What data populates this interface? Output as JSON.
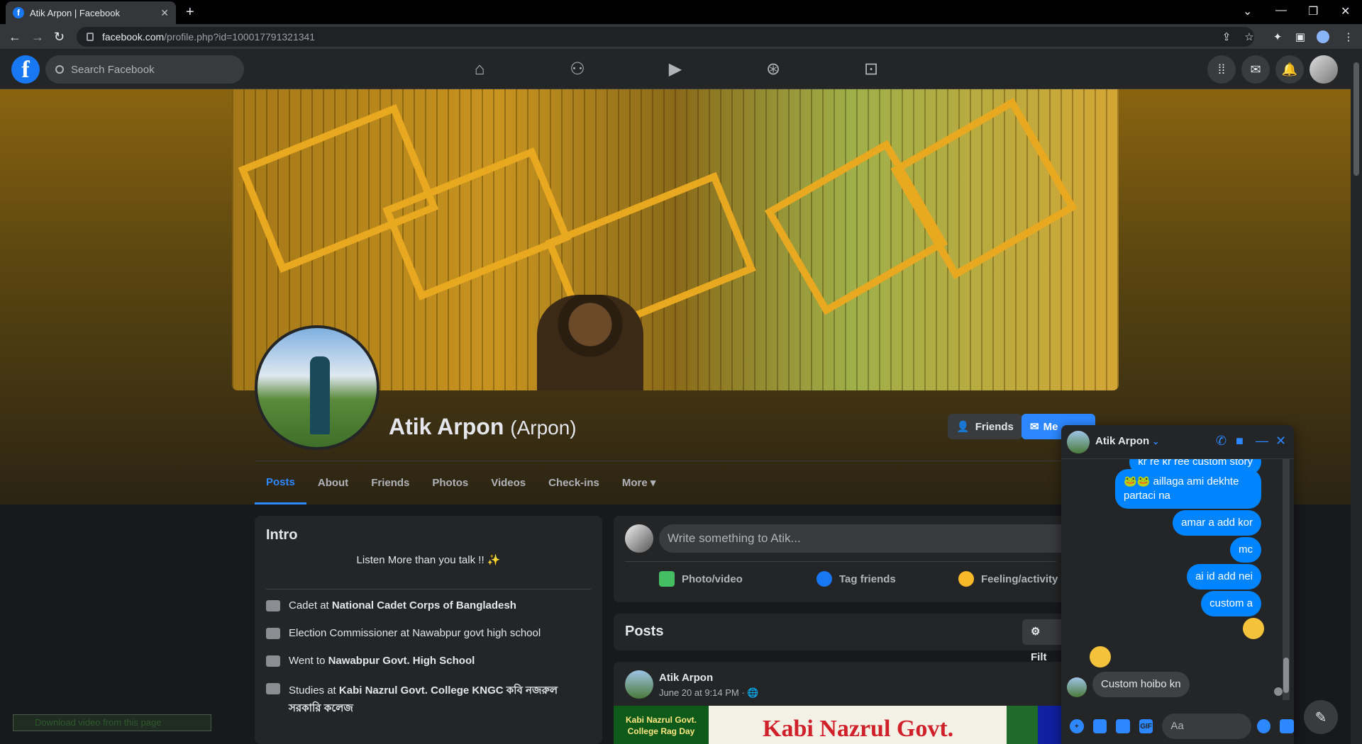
{
  "browser": {
    "tab_title": "Atik Arpon | Facebook",
    "url_host": "facebook.com",
    "url_path": "/profile.php?id=100017791321341"
  },
  "fb": {
    "search_placeholder": "Search Facebook",
    "nav_icons": [
      "home-icon",
      "friends-icon",
      "watch-icon",
      "groups-icon",
      "gaming-icon"
    ],
    "right_icons": [
      "menu-grid-icon",
      "messenger-icon",
      "notifications-icon",
      "account-avatar"
    ]
  },
  "profile": {
    "name": "Atik Arpon",
    "nickname": "(Arpon)",
    "friends_btn": "Friends",
    "message_btn": "Me",
    "tabs": [
      "Posts",
      "About",
      "Friends",
      "Photos",
      "Videos",
      "Check-ins",
      "More ▾"
    ],
    "active_tab": "Posts"
  },
  "intro": {
    "title": "Intro",
    "bio": "Listen More than you talk !! ✨",
    "items": [
      {
        "pre": "Cadet at ",
        "bold": "National Cadet Corps of Bangladesh"
      },
      {
        "pre": "Election Commissioner at Nawabpur govt high school",
        "bold": ""
      },
      {
        "pre": "Went to ",
        "bold": "Nawabpur Govt. High School"
      },
      {
        "pre": "Studies at ",
        "bold": "Kabi Nazrul Govt. College KNGC কবি নজরুল সরকারি কলেজ"
      }
    ]
  },
  "composer": {
    "placeholder": "Write something to Atik...",
    "actions": [
      "Photo/video",
      "Tag friends",
      "Feeling/activity"
    ]
  },
  "posts": {
    "title": "Posts",
    "filter": "Filt",
    "first": {
      "author": "Atik Arpon",
      "meta": "June 20 at 9:14 PM · ",
      "banner_left": "Kabi Nazrul Govt. College Rag Day",
      "banner_title": "Kabi Nazrul Govt. College"
    }
  },
  "chat": {
    "name": "Atik Arpon",
    "messages": [
      {
        "text": "kr re kr ree custom story",
        "from": "me"
      },
      {
        "text": "🐸🐸 aillaga ami dekhte partaci na",
        "from": "me"
      },
      {
        "text": "amar a add kor",
        "from": "me"
      },
      {
        "text": "mc",
        "from": "me"
      },
      {
        "text": "ai id add nei",
        "from": "me"
      },
      {
        "text": "custom a",
        "from": "me"
      },
      {
        "text": "Custom hoibo kn",
        "from": "them"
      }
    ],
    "input_placeholder": "Aa",
    "gif_label": "GIF"
  },
  "extension_bar": "Download video from this page"
}
